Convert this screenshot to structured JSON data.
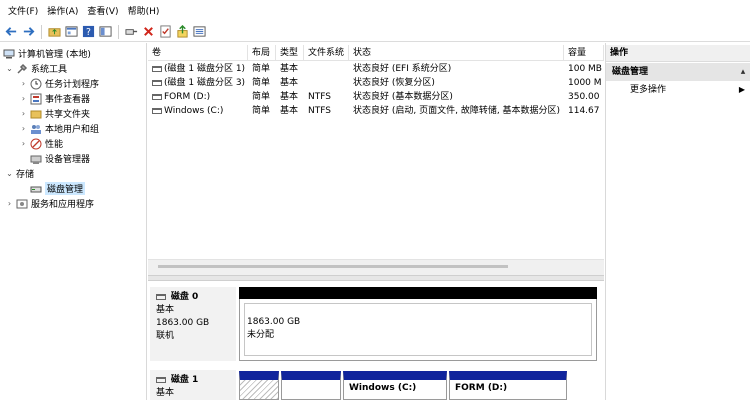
{
  "menu": [
    "文件(F)",
    "操作(A)",
    "查看(V)",
    "帮助(H)"
  ],
  "toolbar_icons": [
    "back-arrow-icon",
    "forward-arrow-icon",
    "folder-up-icon",
    "properties-icon",
    "help-icon",
    "view-pane-icon",
    "connect-icon",
    "delete-icon",
    "check-icon",
    "up-arrow-icon",
    "export-icon"
  ],
  "tree": {
    "root": "计算机管理 (本地)",
    "system_tools": "系统工具",
    "task_scheduler": "任务计划程序",
    "event_viewer": "事件查看器",
    "shared_folders": "共享文件夹",
    "local_users": "本地用户和组",
    "performance": "性能",
    "device_manager": "设备管理器",
    "storage": "存储",
    "disk_mgmt": "磁盘管理",
    "services": "服务和应用程序"
  },
  "columns": [
    "卷",
    "布局",
    "类型",
    "文件系统",
    "状态",
    "容量"
  ],
  "volumes": [
    {
      "vol": "(磁盘 1 磁盘分区 1)",
      "layout": "简单",
      "type": "基本",
      "fs": "",
      "status": "状态良好 (EFI 系统分区)",
      "cap": "100 MB"
    },
    {
      "vol": "(磁盘 1 磁盘分区 3)",
      "layout": "简单",
      "type": "基本",
      "fs": "",
      "status": "状态良好 (恢复分区)",
      "cap": "1000 M"
    },
    {
      "vol": "FORM (D:)",
      "layout": "简单",
      "type": "基本",
      "fs": "NTFS",
      "status": "状态良好 (基本数据分区)",
      "cap": "350.00"
    },
    {
      "vol": "Windows (C:)",
      "layout": "简单",
      "type": "基本",
      "fs": "NTFS",
      "status": "状态良好 (启动, 页面文件, 故障转储, 基本数据分区)",
      "cap": "114.67"
    }
  ],
  "disk0": {
    "name": "磁盘 0",
    "type": "基本",
    "size": "1863.00 GB",
    "state": "联机",
    "part_size": "1863.00 GB",
    "part_state": "未分配"
  },
  "disk1": {
    "name": "磁盘 1",
    "type": "基本",
    "p_windows": "Windows (C:)",
    "p_form": "FORM (D:)"
  },
  "actions": {
    "header": "操作",
    "section": "磁盘管理",
    "more": "更多操作"
  },
  "colors": {
    "primary_partition": "#10249c",
    "selection": "#cce8ff",
    "unallocated": "#000000"
  }
}
